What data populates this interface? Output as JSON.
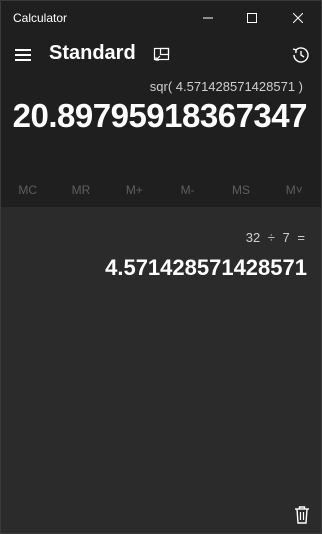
{
  "window": {
    "app_title": "Calculator",
    "controls": [
      "minimize",
      "maximize",
      "close"
    ]
  },
  "header": {
    "mode": "Standard",
    "icons": [
      "menu-icon",
      "keep-on-top-icon",
      "history-icon"
    ]
  },
  "display": {
    "expression": "sqr( 4.571428571428571 )",
    "value": "20.89795918367347"
  },
  "memory": {
    "buttons": [
      "MC",
      "MR",
      "M+",
      "M-",
      "MS",
      "M˅"
    ]
  },
  "history": {
    "items": [
      {
        "expression": "32 ÷ 7 =",
        "result": "4.571428571428571"
      }
    ],
    "clear_icon": "trash-icon"
  },
  "colors": {
    "background": "#1f1f1f",
    "history_panel": "#2b2b2b",
    "text": "#ffffff",
    "muted_text": "#cfcfcf",
    "disabled_text": "#5e5e5e"
  }
}
